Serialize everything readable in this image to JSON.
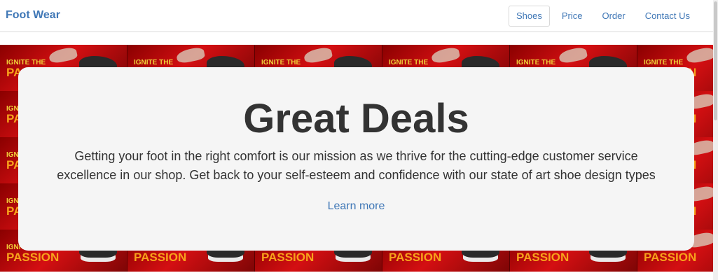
{
  "navbar": {
    "brand": "Foot Wear",
    "links": [
      "Shoes",
      "Price",
      "Order",
      "Contact Us"
    ],
    "active_index": 0
  },
  "hero": {
    "tile_text_top": "IGNITE THE",
    "tile_text_bottom": "PASSION",
    "title": "Great Deals",
    "description": "Getting your foot in the right comfort is our mission as we thrive for the cutting-edge customer service excellence in our shop. Get back to your self-esteem and confidence with our state of art shoe design types",
    "link": "Learn more"
  },
  "colors": {
    "brand": "#3f77b6",
    "banner_red": "#d40f12",
    "card_bg": "#f5f5f5",
    "text": "#333333"
  }
}
